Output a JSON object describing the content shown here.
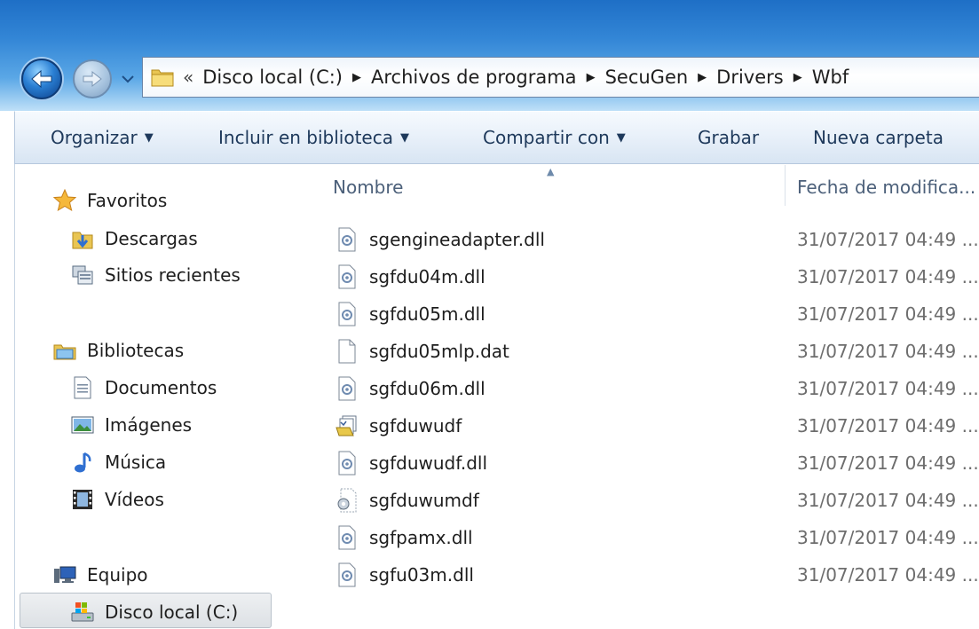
{
  "address": {
    "overflow": "«",
    "crumbs": [
      "Disco local (C:)",
      "Archivos de programa",
      "SecuGen",
      "Drivers",
      "Wbf"
    ]
  },
  "toolbar": {
    "organize": "Organizar",
    "include": "Incluir en biblioteca",
    "share": "Compartir con",
    "burn": "Grabar",
    "new_folder": "Nueva carpeta"
  },
  "nav": {
    "favorites": "Favoritos",
    "downloads": "Descargas",
    "recent": "Sitios recientes",
    "libraries": "Bibliotecas",
    "documents": "Documentos",
    "pictures": "Imágenes",
    "music": "Música",
    "videos": "Vídeos",
    "computer": "Equipo",
    "local_disk": "Disco local (C:)"
  },
  "columns": {
    "name": "Nombre",
    "date": "Fecha de modifica..."
  },
  "files": [
    {
      "name": "sgengineadapter.dll",
      "date": "31/07/2017 04:49 ...",
      "icon": "dll-icon"
    },
    {
      "name": "sgfdu04m.dll",
      "date": "31/07/2017 04:49 ...",
      "icon": "dll-icon"
    },
    {
      "name": "sgfdu05m.dll",
      "date": "31/07/2017 04:49 ...",
      "icon": "dll-icon"
    },
    {
      "name": "sgfdu05mlp.dat",
      "date": "31/07/2017 04:49 ...",
      "icon": "blank-file-icon"
    },
    {
      "name": "sgfdu06m.dll",
      "date": "31/07/2017 04:49 ...",
      "icon": "dll-icon"
    },
    {
      "name": "sgfduwudf",
      "date": "31/07/2017 04:49 ...",
      "icon": "setup-info-icon"
    },
    {
      "name": "sgfduwudf.dll",
      "date": "31/07/2017 04:49 ...",
      "icon": "dll-icon"
    },
    {
      "name": "sgfduwumdf",
      "date": "31/07/2017 04:49 ...",
      "icon": "system-file-icon"
    },
    {
      "name": "sgfpamx.dll",
      "date": "31/07/2017 04:49 ...",
      "icon": "dll-icon"
    },
    {
      "name": "sgfu03m.dll",
      "date": "31/07/2017 04:49 ...",
      "icon": "dll-icon"
    }
  ]
}
